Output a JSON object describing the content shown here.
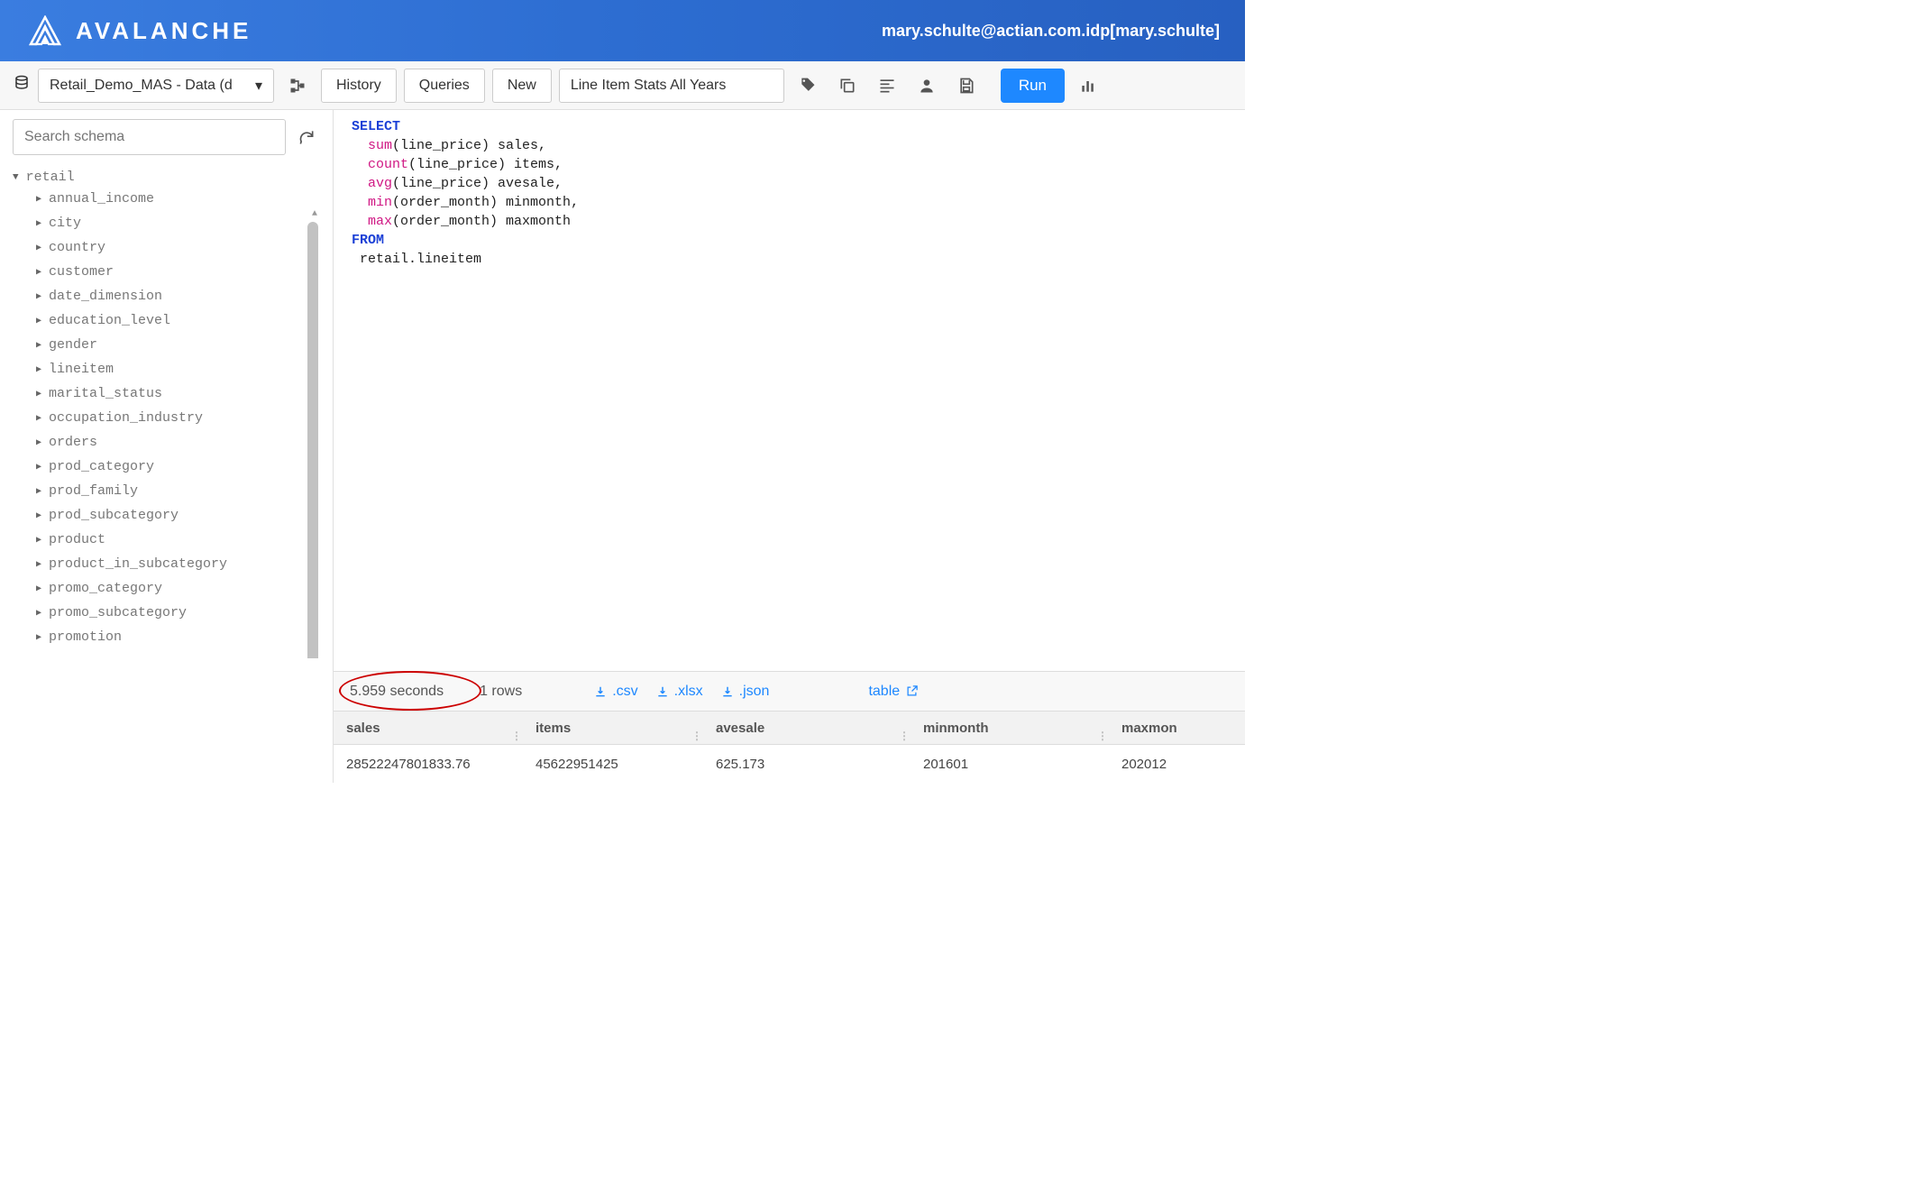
{
  "header": {
    "brand": "AVALANCHE",
    "user": "mary.schulte@actian.com.idp[mary.schulte]"
  },
  "toolbar": {
    "database_selected": "Retail_Demo_MAS - Data (d",
    "history": "History",
    "queries": "Queries",
    "new": "New",
    "query_name": "Line Item Stats All Years",
    "run": "Run"
  },
  "sidebar": {
    "search_placeholder": "Search schema",
    "root": "retail",
    "items": [
      "annual_income",
      "city",
      "country",
      "customer",
      "date_dimension",
      "education_level",
      "gender",
      "lineitem",
      "marital_status",
      "occupation_industry",
      "orders",
      "prod_category",
      "prod_family",
      "prod_subcategory",
      "product",
      "product_in_subcategory",
      "promo_category",
      "promo_subcategory",
      "promotion"
    ]
  },
  "sql": {
    "kw_select": "SELECT",
    "fn_sum": "sum",
    "sum_rest": "(line_price) sales,",
    "fn_count": "count",
    "count_rest": "(line_price) items,",
    "fn_avg": "avg",
    "avg_rest": "(line_price) avesale,",
    "fn_min": "min",
    "min_rest": "(order_month) minmonth,",
    "fn_max": "max",
    "max_rest": "(order_month) maxmonth",
    "kw_from": "FROM",
    "table_line": " retail.lineitem"
  },
  "results": {
    "time": "5.959 seconds",
    "rowcount": "1 rows",
    "downloads": {
      "csv": ".csv",
      "xlsx": ".xlsx",
      "json": ".json"
    },
    "table_label": "table",
    "columns": [
      "sales",
      "items",
      "avesale",
      "minmonth",
      "maxmon"
    ],
    "rows": [
      [
        "28522247801833.76",
        "45622951425",
        "625.173",
        "201601",
        "202012"
      ]
    ]
  }
}
